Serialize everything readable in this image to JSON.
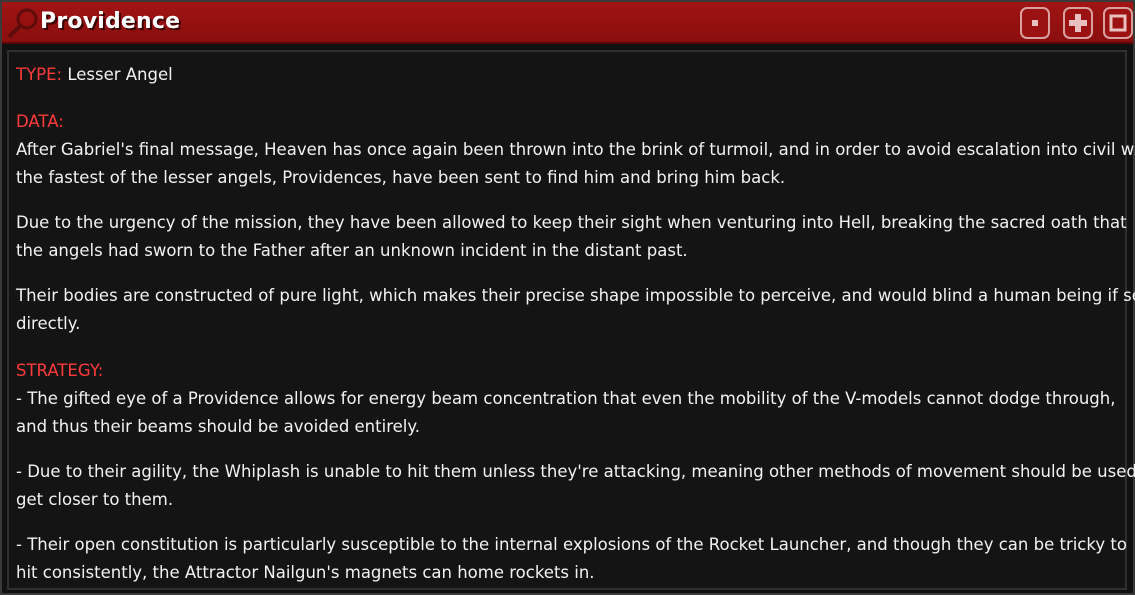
{
  "window": {
    "title": "Providence",
    "buttons": {
      "minimize_icon": "minimize-icon",
      "maximize_icon": "plus-icon",
      "close_icon": "square-icon"
    },
    "title_icon": "magnifier-icon"
  },
  "colors": {
    "titlebar": "#a11414",
    "heading": "#ff3b3b",
    "text": "#f2f2f2",
    "background": "#141414"
  },
  "entry": {
    "type_label": "TYPE:",
    "type_value": "Lesser Angel",
    "data_label": "DATA:",
    "data_paragraphs": [
      [
        "After Gabriel's final message, Heaven has once again been thrown into the brink of turmoil, and in order to avoid escalation into civil war,",
        "the fastest of the lesser angels, Providences, have been sent to find him and bring him back."
      ],
      [
        "Due to the urgency of the mission, they have been allowed to keep their sight when venturing into Hell, breaking the sacred oath that",
        "the angels had sworn to the Father after an unknown incident in the distant past."
      ],
      [
        "Their bodies are constructed of pure light, which makes their precise shape impossible to perceive, and would blind a human being if seen",
        "directly."
      ]
    ],
    "strategy_label": "STRATEGY:",
    "strategy_paragraphs": [
      [
        "- The gifted eye of a Providence allows for energy beam concentration that even the mobility of the V-models cannot dodge through,",
        "and thus their beams should be avoided entirely."
      ],
      [
        "- Due to their agility, the Whiplash is unable to hit them unless they're attacking, meaning other methods of movement should be used to",
        "get closer to them."
      ],
      [
        "- Their open constitution is particularly susceptible to the internal explosions of the Rocket Launcher, and though they can be tricky to",
        "hit consistently, the Attractor Nailgun's magnets can home rockets in."
      ]
    ]
  }
}
